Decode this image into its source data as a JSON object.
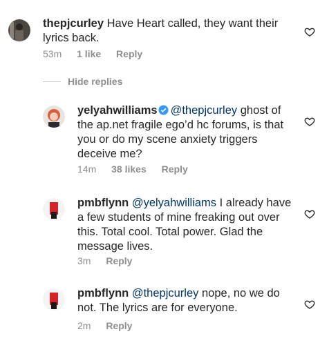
{
  "comments": [
    {
      "username": "thepjcurley",
      "text": "Have Heart called, they want their lyrics back.",
      "mention": "",
      "time": "53m",
      "likes": "1 like",
      "reply": "Reply"
    },
    {
      "username": "yelyahwilliams",
      "mention": "@thepjcurley",
      "text": "ghost of the ap.net fragile ego’d hc forums, is that you or do my scene anxiety triggers deceive me?",
      "time": "14m",
      "likes": "38 likes",
      "reply": "Reply"
    },
    {
      "username": "pmbflynn",
      "mention": "@yelyahwilliams",
      "text": "I already have a few students of mine freaking out over this. Total cool. Total power. Glad the message lives.",
      "time": "3m",
      "reply": "Reply"
    },
    {
      "username": "pmbflynn",
      "mention": "@thepjcurley",
      "text": "nope, no we do not. The lyrics are for everyone.",
      "time": "2m",
      "reply": "Reply"
    }
  ],
  "hide_replies": "Hide replies",
  "colors": {
    "text": "#262626",
    "meta": "#8e8e8e",
    "mention": "#003569",
    "verified": "#3897f0"
  }
}
